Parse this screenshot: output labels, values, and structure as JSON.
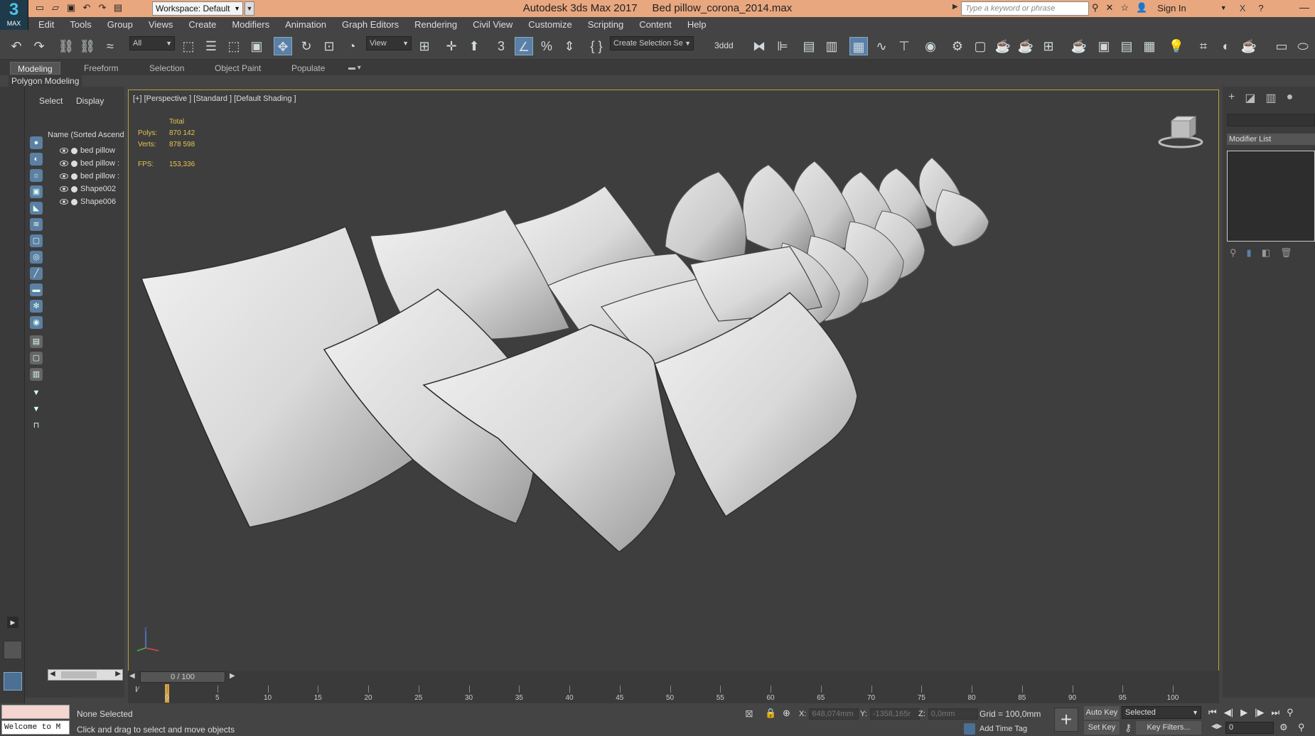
{
  "app": {
    "logo_big": "3",
    "logo_small": "MAX",
    "title": "Autodesk 3ds Max 2017     Bed pillow_corona_2014.max",
    "workspace": "Workspace: Default",
    "search_placeholder": "Type a keyword or phrase",
    "sign_in": "Sign In"
  },
  "menu": [
    "Edit",
    "Tools",
    "Group",
    "Views",
    "Create",
    "Modifiers",
    "Animation",
    "Graph Editors",
    "Rendering",
    "Civil View",
    "Customize",
    "Scripting",
    "Content",
    "Help"
  ],
  "toolbar": {
    "filter_dropdown": "All",
    "ref_coord_dropdown": "View",
    "selection_set": "Create Selection Se",
    "label_3dd": "3ddd"
  },
  "ribbon": {
    "tabs": [
      "Modeling",
      "Freeform",
      "Selection",
      "Object Paint",
      "Populate"
    ],
    "active_tab": "Modeling",
    "sub_label": "Polygon Modeling"
  },
  "explorer": {
    "tabs": [
      "Select",
      "Display"
    ],
    "header": "Name (Sorted Ascend",
    "items": [
      "bed pillow",
      "bed pillow :",
      "bed pillow :",
      "Shape002",
      "Shape006"
    ]
  },
  "viewport": {
    "label": "[+] [Perspective ] [Standard ] [Default Shading ]",
    "stats_header": "Total",
    "polys_label": "Polys:",
    "polys": "870 142",
    "verts_label": "Verts:",
    "verts": "878 598",
    "fps_label": "FPS:",
    "fps": "153,336"
  },
  "command_panel": {
    "modifier_list": "Modifier List"
  },
  "timeline": {
    "slider_label": "0 / 100",
    "ticks": [
      "0",
      "5",
      "10",
      "15",
      "20",
      "25",
      "30",
      "35",
      "40",
      "45",
      "50",
      "55",
      "60",
      "65",
      "70",
      "75",
      "80",
      "85",
      "90",
      "95",
      "100"
    ]
  },
  "status": {
    "maxscript_text": "Welcome to M",
    "selection": "None Selected",
    "prompt": "Click and drag to select and move objects",
    "x_label": "X:",
    "x_value": "648,074mm",
    "y_label": "Y:",
    "y_value": "-1358,165r",
    "z_label": "Z:",
    "z_value": "0,0mm",
    "grid": "Grid = 100,0mm",
    "add_time_tag": "Add Time Tag",
    "auto_key": "Auto Key",
    "set_key": "Set Key",
    "selected_dropdown": "Selected",
    "key_filters": "Key Filters...",
    "frame": "0"
  },
  "colors": {
    "title_bar": "#e8a77f",
    "viewport_border": "#b8a040",
    "stats_text": "#e8c252",
    "accent_blue": "#5a7fa8"
  }
}
